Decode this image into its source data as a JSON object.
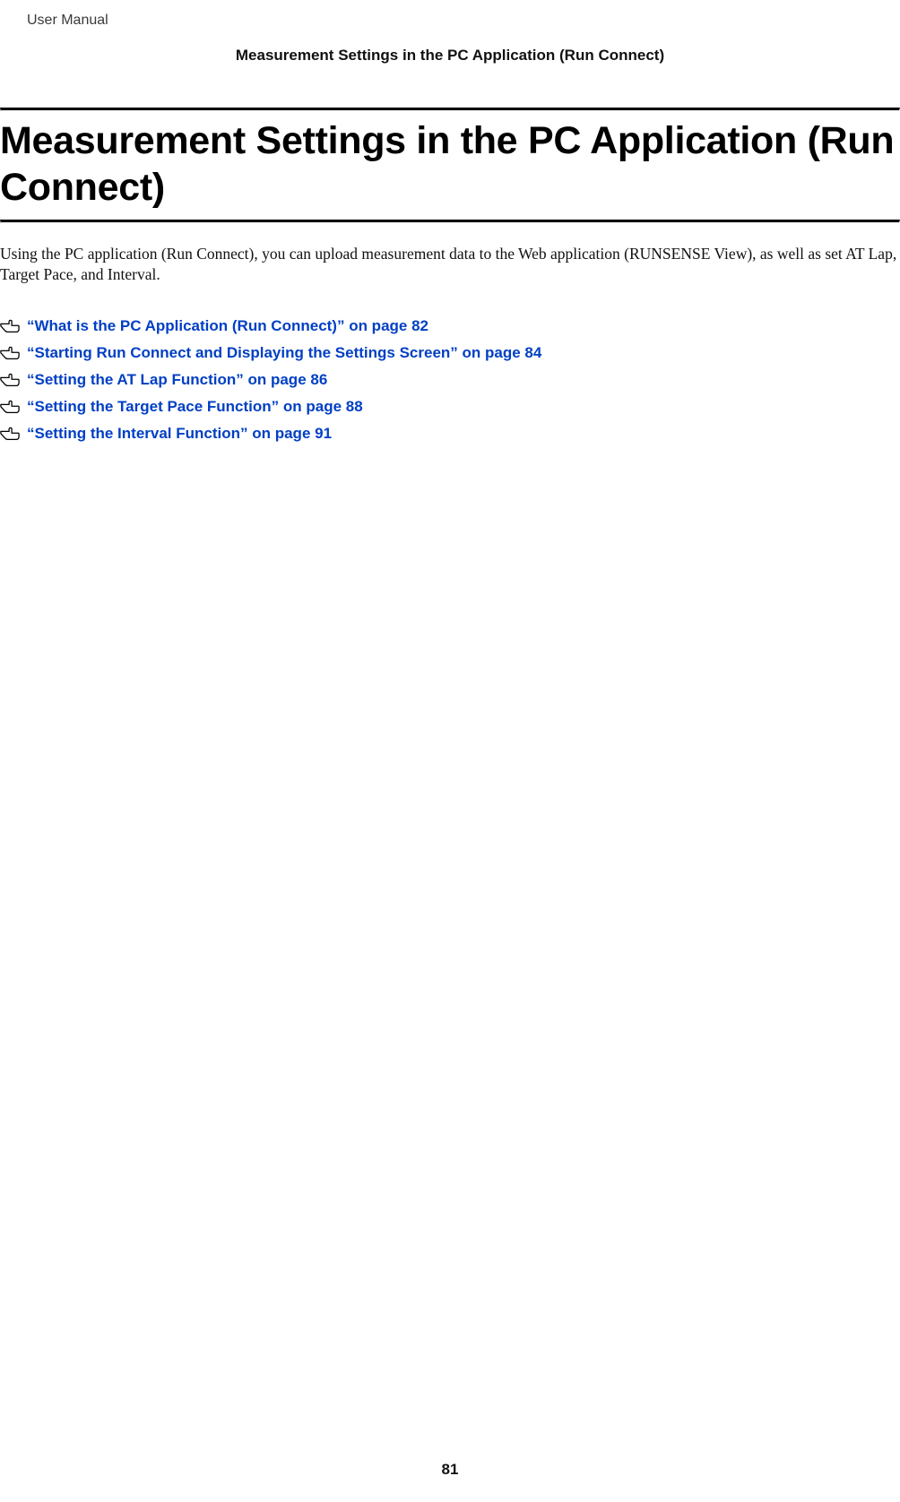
{
  "header": {
    "doc_label": "User Manual",
    "running_header": "Measurement Settings in the PC Application (Run Connect)"
  },
  "title": "Measurement Settings in the PC Application (Run Connect)",
  "intro": "Using the PC application (Run Connect), you can upload measurement data to the Web application (RUNSENSE View), as well as set AT Lap, Target Pace, and Interval.",
  "xrefs": [
    {
      "text": "“What is the PC Application (Run Connect)” on page 82"
    },
    {
      "text": "“Starting Run Connect and Displaying the Settings Screen” on page 84"
    },
    {
      "text": "“Setting the AT Lap Function” on page 86"
    },
    {
      "text": "“Setting the Target Pace Function” on page 88"
    },
    {
      "text": "“Setting the Interval Function” on page 91"
    }
  ],
  "page_number": "81"
}
